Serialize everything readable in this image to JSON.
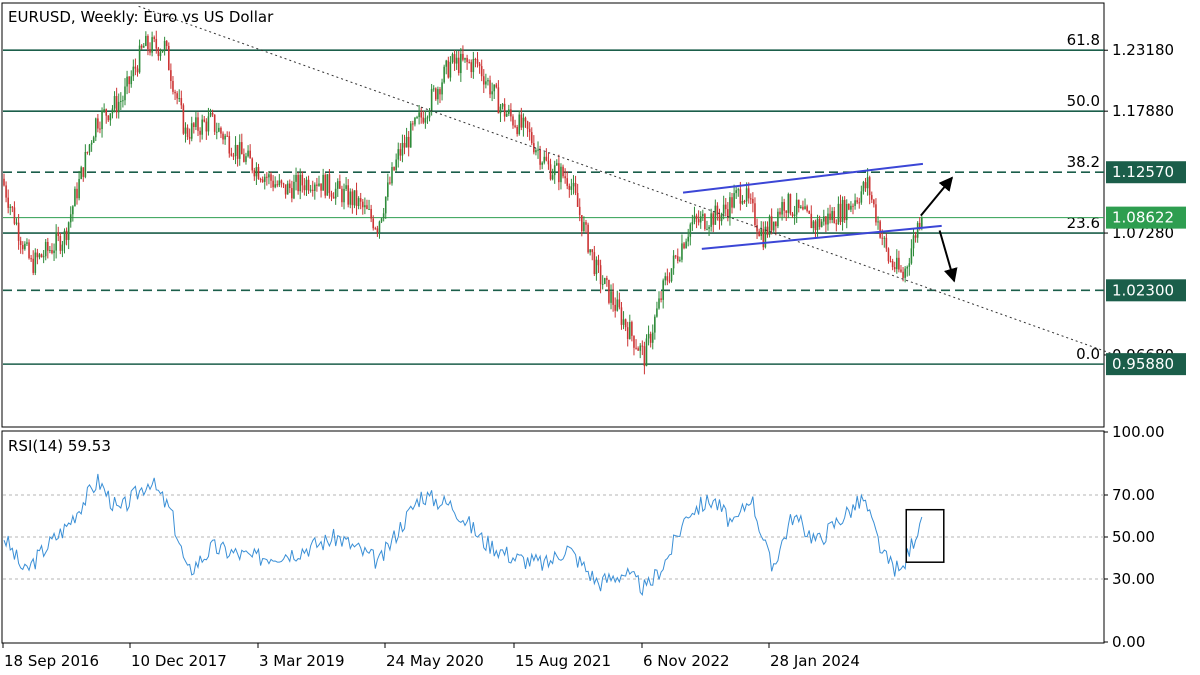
{
  "colors": {
    "up": "#2e8b3a",
    "down": "#cc3333",
    "level": "#1b5e4a",
    "channel": "#3b46d6",
    "rsi": "#3a8fd6",
    "current_tag": "#2e9e50",
    "level_tag": "#1b5e4a"
  },
  "chart_data": [
    {
      "type": "candlestick",
      "title": "EURUSD, Weekly:  Euro vs US Dollar",
      "ylim": [
        0.905,
        1.272
      ],
      "y_ticks": [
        "1.23180",
        "1.17880",
        "1.07280",
        "0.96680"
      ],
      "x_ticks": [
        "18 Sep 2016",
        "10 Dec 2017",
        "3 Mar 2019",
        "24 May 2020",
        "15 Aug 2021",
        "6 Nov 2022",
        "28 Jan 2024"
      ],
      "current_price": "1.08622",
      "price_path": [
        {
          "week": 0,
          "price": 1.12
        },
        {
          "week": 8,
          "price": 1.075
        },
        {
          "week": 14,
          "price": 1.045
        },
        {
          "week": 30,
          "price": 1.07
        },
        {
          "week": 45,
          "price": 1.17
        },
        {
          "week": 58,
          "price": 1.19
        },
        {
          "week": 68,
          "price": 1.235
        },
        {
          "week": 78,
          "price": 1.235
        },
        {
          "week": 88,
          "price": 1.16
        },
        {
          "week": 100,
          "price": 1.17
        },
        {
          "week": 115,
          "price": 1.14
        },
        {
          "week": 135,
          "price": 1.11
        },
        {
          "week": 150,
          "price": 1.12
        },
        {
          "week": 170,
          "price": 1.1
        },
        {
          "week": 180,
          "price": 1.08
        },
        {
          "week": 190,
          "price": 1.14
        },
        {
          "week": 203,
          "price": 1.18
        },
        {
          "week": 215,
          "price": 1.22
        },
        {
          "week": 228,
          "price": 1.22
        },
        {
          "week": 240,
          "price": 1.18
        },
        {
          "week": 252,
          "price": 1.16
        },
        {
          "week": 262,
          "price": 1.13
        },
        {
          "week": 272,
          "price": 1.12
        },
        {
          "week": 285,
          "price": 1.04
        },
        {
          "week": 297,
          "price": 1.0
        },
        {
          "week": 308,
          "price": 0.965
        },
        {
          "week": 318,
          "price": 1.03
        },
        {
          "week": 330,
          "price": 1.08
        },
        {
          "week": 345,
          "price": 1.09
        },
        {
          "week": 355,
          "price": 1.11
        },
        {
          "week": 365,
          "price": 1.07
        },
        {
          "week": 375,
          "price": 1.1
        },
        {
          "week": 390,
          "price": 1.08
        },
        {
          "week": 405,
          "price": 1.095
        },
        {
          "week": 415,
          "price": 1.115
        },
        {
          "week": 425,
          "price": 1.05
        },
        {
          "week": 432,
          "price": 1.035
        },
        {
          "week": 440,
          "price": 1.086
        }
      ],
      "levels": [
        {
          "label": "61.8",
          "price": 1.2318,
          "style": "solid"
        },
        {
          "label": "50.0",
          "price": 1.1788,
          "style": "solid"
        },
        {
          "label": "38.2",
          "price": 1.1257,
          "style": "dashed"
        },
        {
          "label": "23.6",
          "price": 1.0728,
          "style": "solid"
        },
        {
          "label": "",
          "price": 1.023,
          "style": "dashed"
        },
        {
          "label": "0.0",
          "price": 0.9588,
          "style": "solid"
        }
      ],
      "price_tags": [
        {
          "label": "1.12570",
          "price": 1.1257,
          "kind": "level"
        },
        {
          "label": "1.08622",
          "price": 1.08622,
          "kind": "current"
        },
        {
          "label": "1.02300",
          "price": 1.023,
          "kind": "level"
        },
        {
          "label": "0.95880",
          "price": 0.9588,
          "kind": "level"
        }
      ],
      "trendline": {
        "from": {
          "week": 65,
          "price": 1.27
        },
        "to": {
          "week": 533,
          "price": 0.967
        }
      },
      "channel": [
        {
          "from": {
            "week": 326,
            "price": 1.108
          },
          "to": {
            "week": 441,
            "price": 1.133
          }
        },
        {
          "from": {
            "week": 335,
            "price": 1.059
          },
          "to": {
            "week": 450,
            "price": 1.079
          }
        }
      ],
      "arrows": [
        {
          "from": {
            "week": 440,
            "price": 1.088
          },
          "to": {
            "week": 455,
            "price": 1.121
          }
        },
        {
          "from": {
            "week": 449,
            "price": 1.075
          },
          "to": {
            "week": 456,
            "price": 1.031
          }
        }
      ]
    },
    {
      "type": "line",
      "title": "RSI(14) 59.53",
      "ylim": [
        0,
        100
      ],
      "y_ticks": [
        "100.00",
        "70.00",
        "50.00",
        "30.00",
        "0.00"
      ],
      "gridlines": [
        70,
        50,
        30
      ],
      "rsi_path": [
        {
          "week": 0,
          "value": 50
        },
        {
          "week": 10,
          "value": 33
        },
        {
          "week": 20,
          "value": 45
        },
        {
          "week": 30,
          "value": 55
        },
        {
          "week": 45,
          "value": 77
        },
        {
          "week": 55,
          "value": 62
        },
        {
          "week": 70,
          "value": 77
        },
        {
          "week": 80,
          "value": 62
        },
        {
          "week": 88,
          "value": 33
        },
        {
          "week": 100,
          "value": 45
        },
        {
          "week": 120,
          "value": 40
        },
        {
          "week": 140,
          "value": 43
        },
        {
          "week": 160,
          "value": 50
        },
        {
          "week": 180,
          "value": 38
        },
        {
          "week": 190,
          "value": 55
        },
        {
          "week": 200,
          "value": 70
        },
        {
          "week": 215,
          "value": 65
        },
        {
          "week": 230,
          "value": 48
        },
        {
          "week": 245,
          "value": 40
        },
        {
          "week": 260,
          "value": 37
        },
        {
          "week": 270,
          "value": 45
        },
        {
          "week": 285,
          "value": 28
        },
        {
          "week": 297,
          "value": 33
        },
        {
          "week": 308,
          "value": 25
        },
        {
          "week": 318,
          "value": 40
        },
        {
          "week": 328,
          "value": 62
        },
        {
          "week": 340,
          "value": 68
        },
        {
          "week": 350,
          "value": 55
        },
        {
          "week": 358,
          "value": 70
        },
        {
          "week": 368,
          "value": 35
        },
        {
          "week": 378,
          "value": 60
        },
        {
          "week": 390,
          "value": 48
        },
        {
          "week": 400,
          "value": 58
        },
        {
          "week": 412,
          "value": 68
        },
        {
          "week": 422,
          "value": 40
        },
        {
          "week": 430,
          "value": 33
        },
        {
          "week": 440,
          "value": 59.53
        }
      ],
      "highlight_box": {
        "week_from": 433,
        "week_to": 451,
        "value_from": 38,
        "value_to": 63
      }
    }
  ]
}
